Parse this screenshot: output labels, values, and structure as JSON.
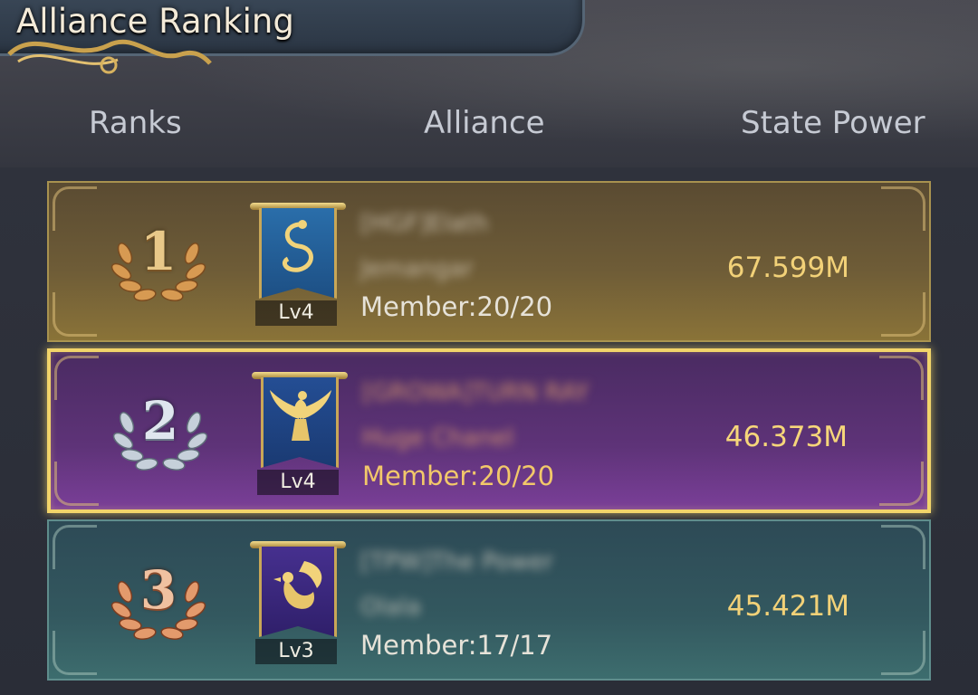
{
  "header": {
    "title": "Alliance Ranking",
    "columns": {
      "ranks": "Ranks",
      "alliance": "Alliance",
      "power": "State Power"
    }
  },
  "rows": [
    {
      "rank": "1",
      "level": "Lv4",
      "alliance_name": "[HGF]Elath",
      "alliance_sub": "Jemangar",
      "members": "Member:20/20",
      "power": "67.599M",
      "banner": "serpent-emblem"
    },
    {
      "rank": "2",
      "level": "Lv4",
      "alliance_name": "[GROWA]TURN RAY",
      "alliance_sub": "Huge Chanel",
      "members": "Member:20/20",
      "power": "46.373M",
      "banner": "eagle-emblem"
    },
    {
      "rank": "3",
      "level": "Lv3",
      "alliance_name": "[TPW]The Power",
      "alliance_sub": "Olala",
      "members": "Member:17/17",
      "power": "45.421M",
      "banner": "griffin-emblem"
    }
  ],
  "colors": {
    "gold_text": "#f2d178",
    "rank1": "#8a7338",
    "rank2_highlight": "#f2d46a",
    "rank3": "#3d6d6e"
  }
}
